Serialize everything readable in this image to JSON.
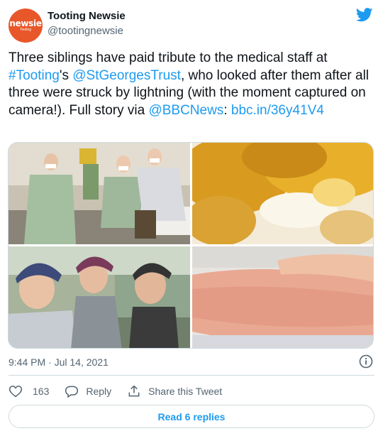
{
  "account": {
    "name": "Tooting Newsie",
    "handle": "@tootingnewsie",
    "avatar_brand": "newsie",
    "avatar_sub": "Tooting"
  },
  "tweet": {
    "segments": [
      {
        "text": "Three siblings have paid tribute to the medical staff at ",
        "link": false
      },
      {
        "text": "#Tooting",
        "link": true
      },
      {
        "text": "'s ",
        "link": false
      },
      {
        "text": "@StGeorgesTrust",
        "link": true
      },
      {
        "text": ", who looked after them after all three were struck by lightning (with the moment captured on camera!). Full story via ",
        "link": false
      },
      {
        "text": "@BBCNews",
        "link": true
      },
      {
        "text": ": ",
        "link": false
      },
      {
        "text": "bbc.in/36y41V4",
        "link": true
      }
    ]
  },
  "timestamp": "9:44 PM · Jul 14, 2021",
  "actions": {
    "like_count": "163",
    "reply_label": "Reply",
    "share_label": "Share this Tweet"
  },
  "replies_button_label": "Read 6 replies",
  "colors": {
    "link": "#1d9bf0",
    "avatar_bg": "#e8572a",
    "secondary_text": "#536471"
  },
  "icons": [
    "twitter-bird-icon",
    "info-icon",
    "heart-icon",
    "reply-icon",
    "share-icon"
  ]
}
